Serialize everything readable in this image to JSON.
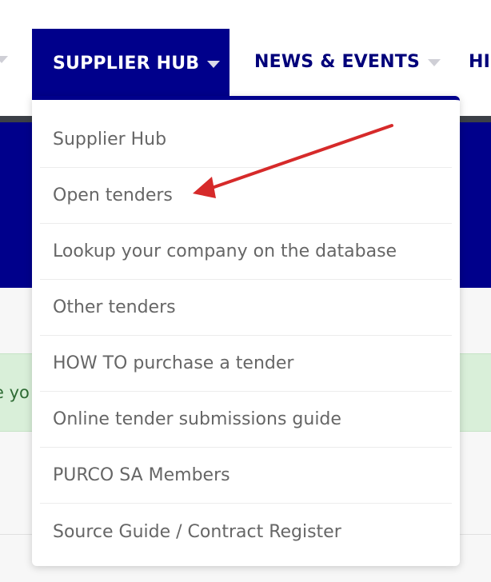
{
  "nav": {
    "items": [
      {
        "label": "SUPPLIER HUB",
        "active": true
      },
      {
        "label": "NEWS & EVENTS",
        "active": false
      },
      {
        "label": "HI",
        "active": false
      }
    ]
  },
  "dropdown": {
    "items": [
      {
        "label": "Supplier Hub"
      },
      {
        "label": "Open tenders"
      },
      {
        "label": "Lookup your company on the database"
      },
      {
        "label": "Other tenders"
      },
      {
        "label": "HOW TO purchase a tender"
      },
      {
        "label": "Online tender submissions guide"
      },
      {
        "label": "PURCO SA Members"
      },
      {
        "label": "Source Guide / Contract Register"
      }
    ]
  },
  "alert": {
    "text": "e yo"
  },
  "annotation": {
    "target": "Open tenders",
    "color": "#d62a2a"
  },
  "colors": {
    "brand": "#00008b",
    "nav_text": "#00007a",
    "menu_text": "#666666",
    "alert_bg": "#d9efd9"
  }
}
